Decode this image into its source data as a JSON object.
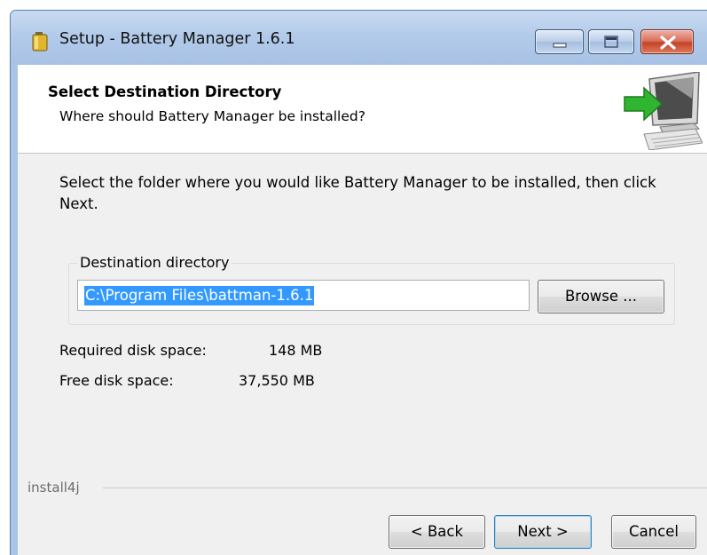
{
  "window": {
    "title": "Setup - Battery Manager 1.6.1",
    "controls": {
      "minimize": "minimize-icon",
      "maximize": "maximize-icon",
      "close": "close-icon"
    }
  },
  "header": {
    "title": "Select Destination Directory",
    "subtitle": "Where should Battery Manager be installed?"
  },
  "body": {
    "instruction": "Select the folder where you would like Battery Manager to be installed, then click Next.",
    "destination": {
      "legend": "Destination directory",
      "value": "C:\\Program Files\\battman-1.6.1",
      "browse_label": "Browse ..."
    },
    "disk": {
      "required_label": "Required disk space:",
      "required_value": "148 MB",
      "free_label": "Free disk space:",
      "free_value": "37,550 MB"
    }
  },
  "footer": {
    "brand": "install4j",
    "back_label": "< Back",
    "next_label": "Next >",
    "cancel_label": "Cancel"
  },
  "colors": {
    "selection": "#3399ff",
    "title_bar": "#b3cbea",
    "close_button": "#c6432b",
    "arrow_green": "#2fb52f"
  }
}
